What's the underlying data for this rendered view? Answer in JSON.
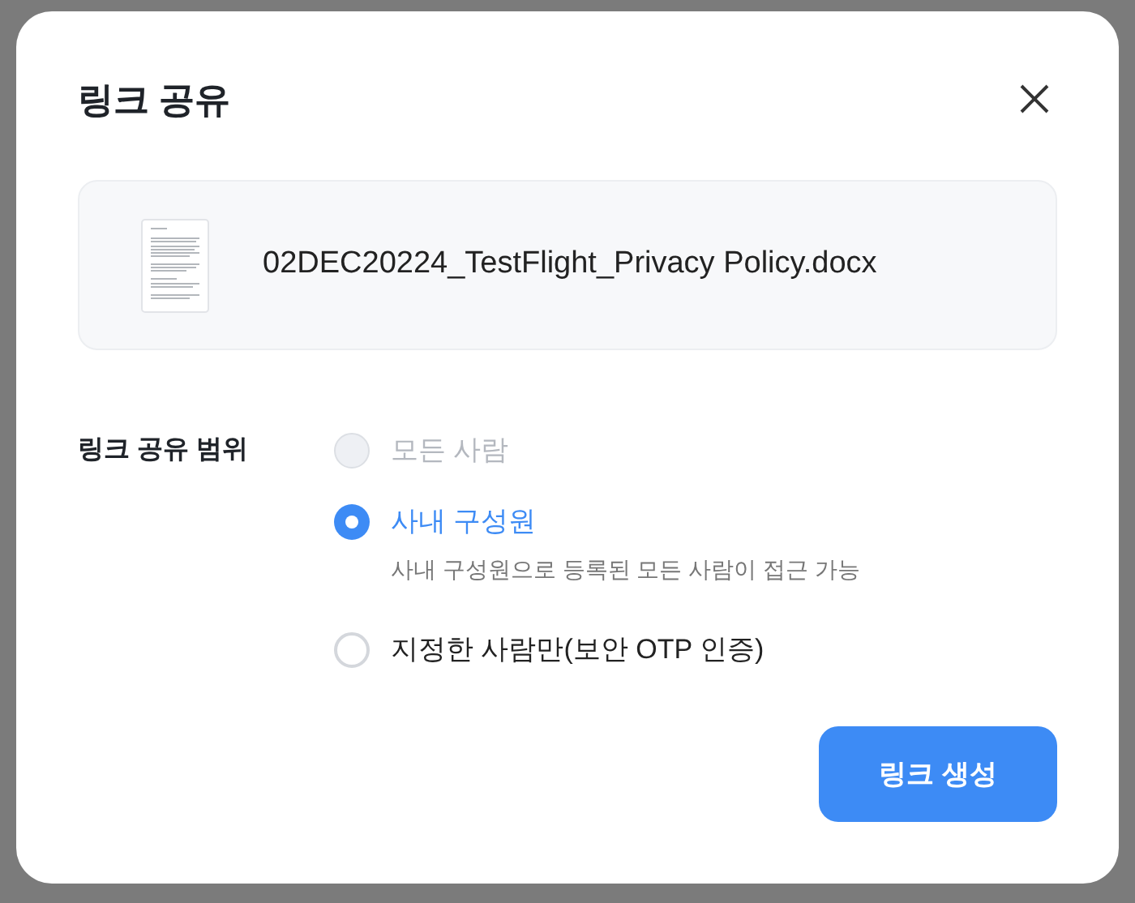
{
  "dialog": {
    "title": "링크 공유",
    "file": {
      "name": "02DEC20224_TestFlight_Privacy Policy.docx"
    },
    "scope": {
      "label": "링크 공유 범위",
      "options": [
        {
          "label": "모든 사람",
          "selected": false,
          "disabled": true
        },
        {
          "label": "사내 구성원",
          "selected": true,
          "disabled": false,
          "description": "사내 구성원으로 등록된 모든 사람이 접근 가능"
        },
        {
          "label": "지정한 사람만(보안 OTP 인증)",
          "selected": false,
          "disabled": false
        }
      ]
    },
    "buttons": [
      {
        "label": "링크 생성",
        "kind": "primary"
      }
    ]
  }
}
